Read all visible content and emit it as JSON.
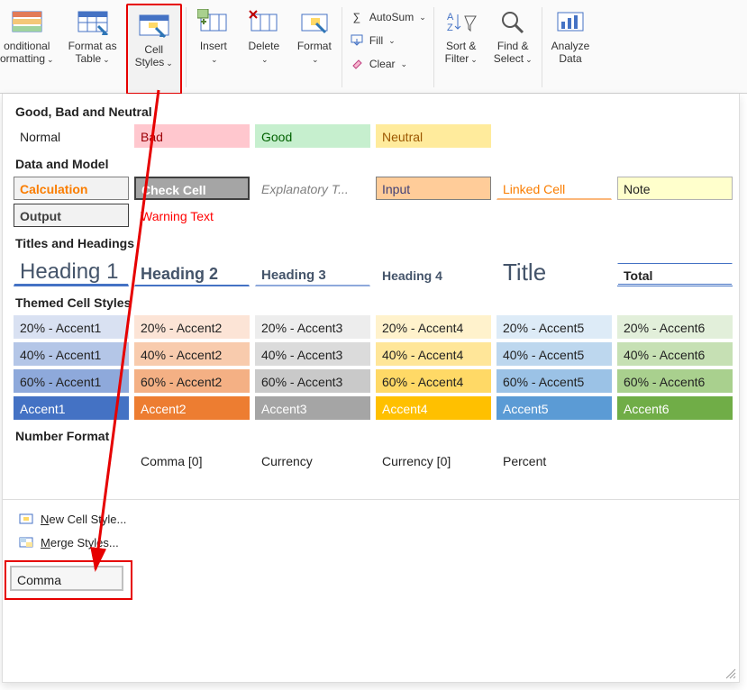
{
  "ribbon": {
    "conditional_fmt": "onditional\normatting",
    "format_table": "Format as\nTable",
    "cell_styles": "Cell\nStyles",
    "insert": "Insert",
    "delete": "Delete",
    "format": "Format",
    "autosum": "AutoSum",
    "fill": "Fill",
    "clear": "Clear",
    "sort_filter": "Sort &\nFilter",
    "find_select": "Find &\nSelect",
    "analyze": "Analyze\nData"
  },
  "sections": {
    "good_bad": "Good, Bad and Neutral",
    "data_model": "Data and Model",
    "titles": "Titles and Headings",
    "themed": "Themed Cell Styles",
    "number": "Number Format"
  },
  "styles": {
    "normal": "Normal",
    "bad": "Bad",
    "good": "Good",
    "neutral": "Neutral",
    "calculation": "Calculation",
    "check_cell": "Check Cell",
    "explanatory": "Explanatory T...",
    "input": "Input",
    "linked_cell": "Linked Cell",
    "note": "Note",
    "output": "Output",
    "warning": "Warning Text",
    "h1": "Heading 1",
    "h2": "Heading 2",
    "h3": "Heading 3",
    "h4": "Heading 4",
    "title": "Title",
    "total": "Total",
    "a1": [
      "20% - Accent1",
      "20% - Accent2",
      "20% - Accent3",
      "20% - Accent4",
      "20% - Accent5",
      "20% - Accent6"
    ],
    "a2": [
      "40% - Accent1",
      "40% - Accent2",
      "40% - Accent3",
      "40% - Accent4",
      "40% - Accent5",
      "40% - Accent6"
    ],
    "a3": [
      "60% - Accent1",
      "60% - Accent2",
      "60% - Accent3",
      "60% - Accent4",
      "60% - Accent5",
      "60% - Accent6"
    ],
    "a4": [
      "Accent1",
      "Accent2",
      "Accent3",
      "Accent4",
      "Accent5",
      "Accent6"
    ],
    "comma": "Comma",
    "comma0": "Comma [0]",
    "currency": "Currency",
    "currency0": "Currency [0]",
    "percent": "Percent"
  },
  "actions": {
    "new_style_prefix": "N",
    "new_style_rest": "ew Cell Style...",
    "merge_prefix": "M",
    "merge_rest": "erge Styles..."
  },
  "colors": {
    "accent1": [
      "#d9e1f2",
      "#b4c6e7",
      "#8ea9db",
      "#4472c4"
    ],
    "accent2": [
      "#fce4d6",
      "#f8cbad",
      "#f4b084",
      "#ed7d31"
    ],
    "accent3": [
      "#ededed",
      "#dbdbdb",
      "#c9c9c9",
      "#a5a5a5"
    ],
    "accent4": [
      "#fff2cc",
      "#ffe699",
      "#ffd966",
      "#ffc000"
    ],
    "accent5": [
      "#ddebf7",
      "#bdd7ee",
      "#9bc2e6",
      "#5b9bd5"
    ],
    "accent6": [
      "#e2efda",
      "#c6e0b4",
      "#a9d08e",
      "#70ad47"
    ],
    "bad_bg": "#ffc7ce",
    "bad_fg": "#9c0006",
    "good_bg": "#c6efce",
    "good_fg": "#006100",
    "neutral_bg": "#ffeb9c",
    "neutral_fg": "#9c5700",
    "calc_fg": "#fa7d00",
    "calc_bg": "#f2f2f2",
    "check_bg": "#a5a5a5",
    "check_fg": "#ffffff",
    "input_bg": "#ffcc99",
    "input_fg": "#3f3f76",
    "linked_fg": "#fa7d00",
    "note_bg": "#ffffcc",
    "output_bg": "#f2f2f2",
    "output_fg": "#3f3f3f",
    "warning_fg": "#ff0000",
    "explanatory_fg": "#7f7f7f"
  }
}
